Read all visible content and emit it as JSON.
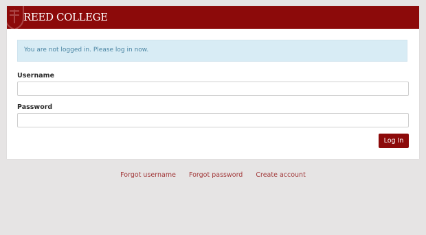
{
  "header": {
    "brand": "REED COLLEGE",
    "color": "#8c0a0a"
  },
  "alert": {
    "message": "You are not logged in. Please log in now."
  },
  "form": {
    "username_label": "Username",
    "username_value": "",
    "password_label": "Password",
    "password_value": "",
    "submit_label": "Log In"
  },
  "footer": {
    "links": [
      "Forgot username",
      "Forgot password",
      "Create account"
    ]
  }
}
